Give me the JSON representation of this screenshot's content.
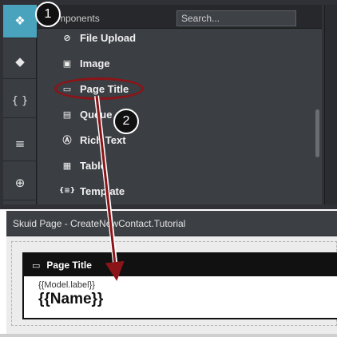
{
  "rail": {
    "buttons": [
      {
        "name": "components-icon",
        "glyph": "❖",
        "active": true
      },
      {
        "name": "models-icon",
        "glyph": "◆",
        "active": false
      },
      {
        "name": "javascript-icon",
        "glyph": "{ }",
        "active": false
      },
      {
        "name": "css-icon",
        "glyph": "≡",
        "active": false
      },
      {
        "name": "globe-icon",
        "glyph": "⊕",
        "active": false
      }
    ]
  },
  "components_panel": {
    "title": "mponents",
    "search_placeholder": "Search...",
    "items": [
      {
        "label": "File Upload",
        "icon": "upload-icon",
        "glyph": "⊘"
      },
      {
        "label": "Image",
        "icon": "image-icon",
        "glyph": "▣"
      },
      {
        "label": "Page Title",
        "icon": "page-title-icon",
        "glyph": "▭"
      },
      {
        "label": "Queue",
        "icon": "queue-icon",
        "glyph": "▤"
      },
      {
        "label": "Rich Text",
        "icon": "rich-text-icon",
        "glyph": "Ⓐ"
      },
      {
        "label": "Table",
        "icon": "table-icon",
        "glyph": "▦"
      },
      {
        "label": "Template",
        "icon": "template-icon",
        "glyph": "{≡}"
      }
    ]
  },
  "page": {
    "header_label": "Skuid Page - CreateNewContact.Tutorial",
    "card": {
      "title": "Page Title",
      "subtitle": "{{Model.label}}",
      "main": "{{Name}}"
    }
  },
  "callouts": {
    "step1": "1",
    "step2": "2"
  },
  "colors": {
    "accent": "#4aa3bd",
    "highlight": "#8b1418",
    "panel": "#3b3e43"
  }
}
